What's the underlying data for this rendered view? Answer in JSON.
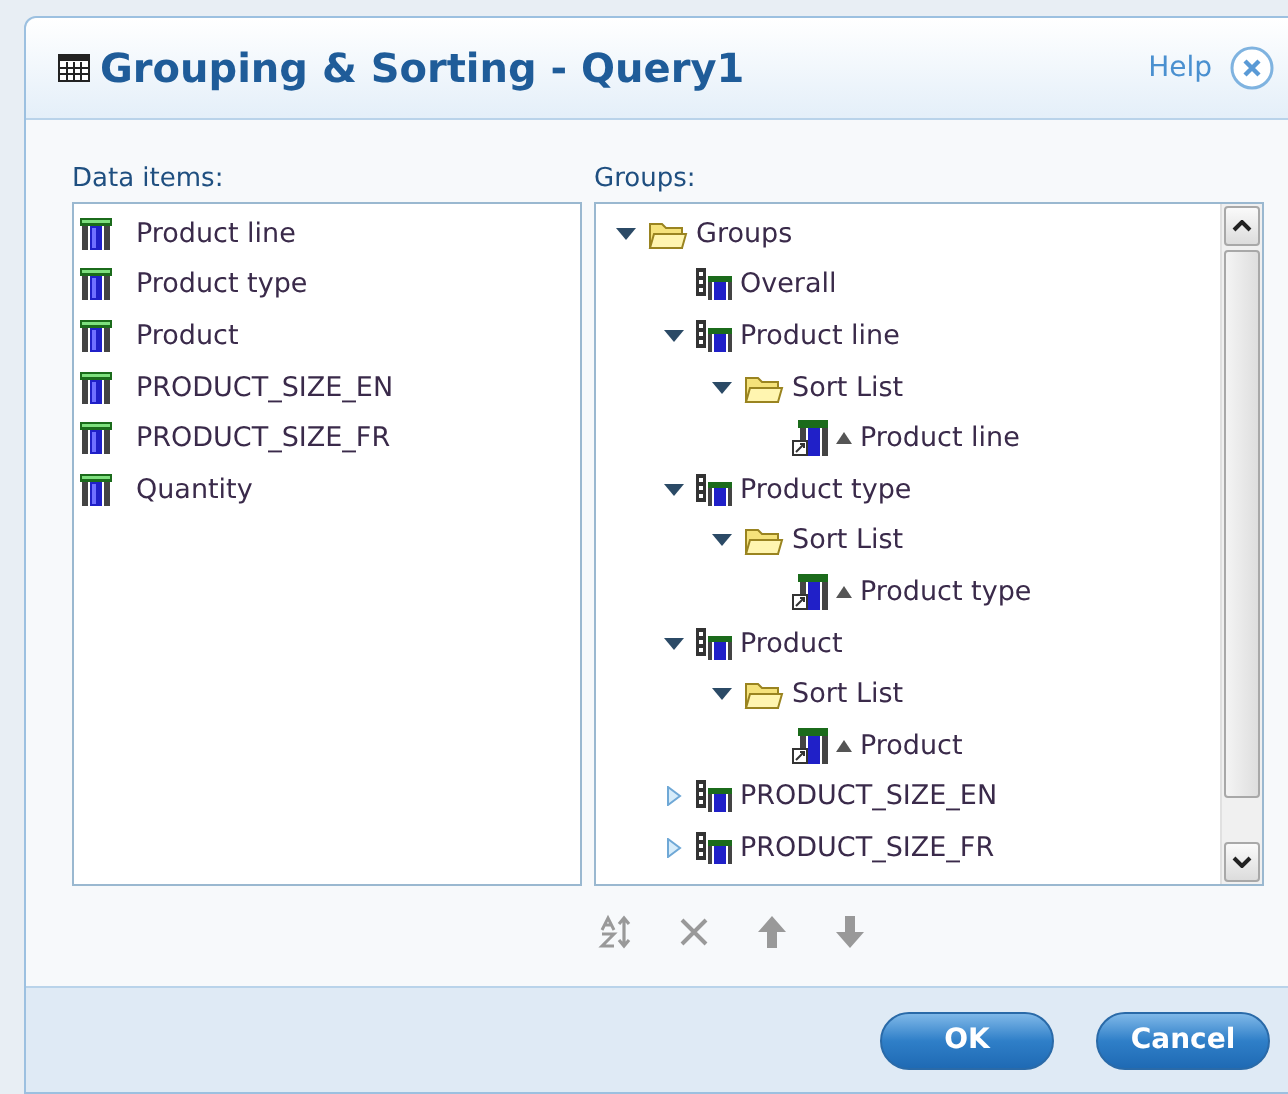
{
  "dialog": {
    "title": "Grouping & Sorting - Query1",
    "help": "Help"
  },
  "data_items": {
    "label": "Data items:",
    "items": [
      "Product line",
      "Product type",
      "Product",
      "PRODUCT_SIZE_EN",
      "PRODUCT_SIZE_FR",
      "Quantity"
    ]
  },
  "groups": {
    "label": "Groups:",
    "tree": [
      {
        "kind": "folder",
        "label": "Groups",
        "expanded": true,
        "children": [
          {
            "kind": "group",
            "label": "Overall"
          },
          {
            "kind": "group",
            "label": "Product line",
            "expanded": true,
            "children": [
              {
                "kind": "folder",
                "label": "Sort List",
                "expanded": true,
                "children": [
                  {
                    "kind": "sort",
                    "label": "Product line"
                  }
                ]
              }
            ]
          },
          {
            "kind": "group",
            "label": "Product type",
            "expanded": true,
            "children": [
              {
                "kind": "folder",
                "label": "Sort List",
                "expanded": true,
                "children": [
                  {
                    "kind": "sort",
                    "label": "Product type"
                  }
                ]
              }
            ]
          },
          {
            "kind": "group",
            "label": "Product",
            "expanded": true,
            "children": [
              {
                "kind": "folder",
                "label": "Sort List",
                "expanded": true,
                "children": [
                  {
                    "kind": "sort",
                    "label": "Product"
                  }
                ]
              }
            ]
          },
          {
            "kind": "group",
            "label": "PRODUCT_SIZE_EN",
            "expanded": false
          },
          {
            "kind": "group",
            "label": "PRODUCT_SIZE_FR",
            "expanded": false
          }
        ]
      }
    ]
  },
  "buttons": [
    "OK",
    "Cancel"
  ]
}
